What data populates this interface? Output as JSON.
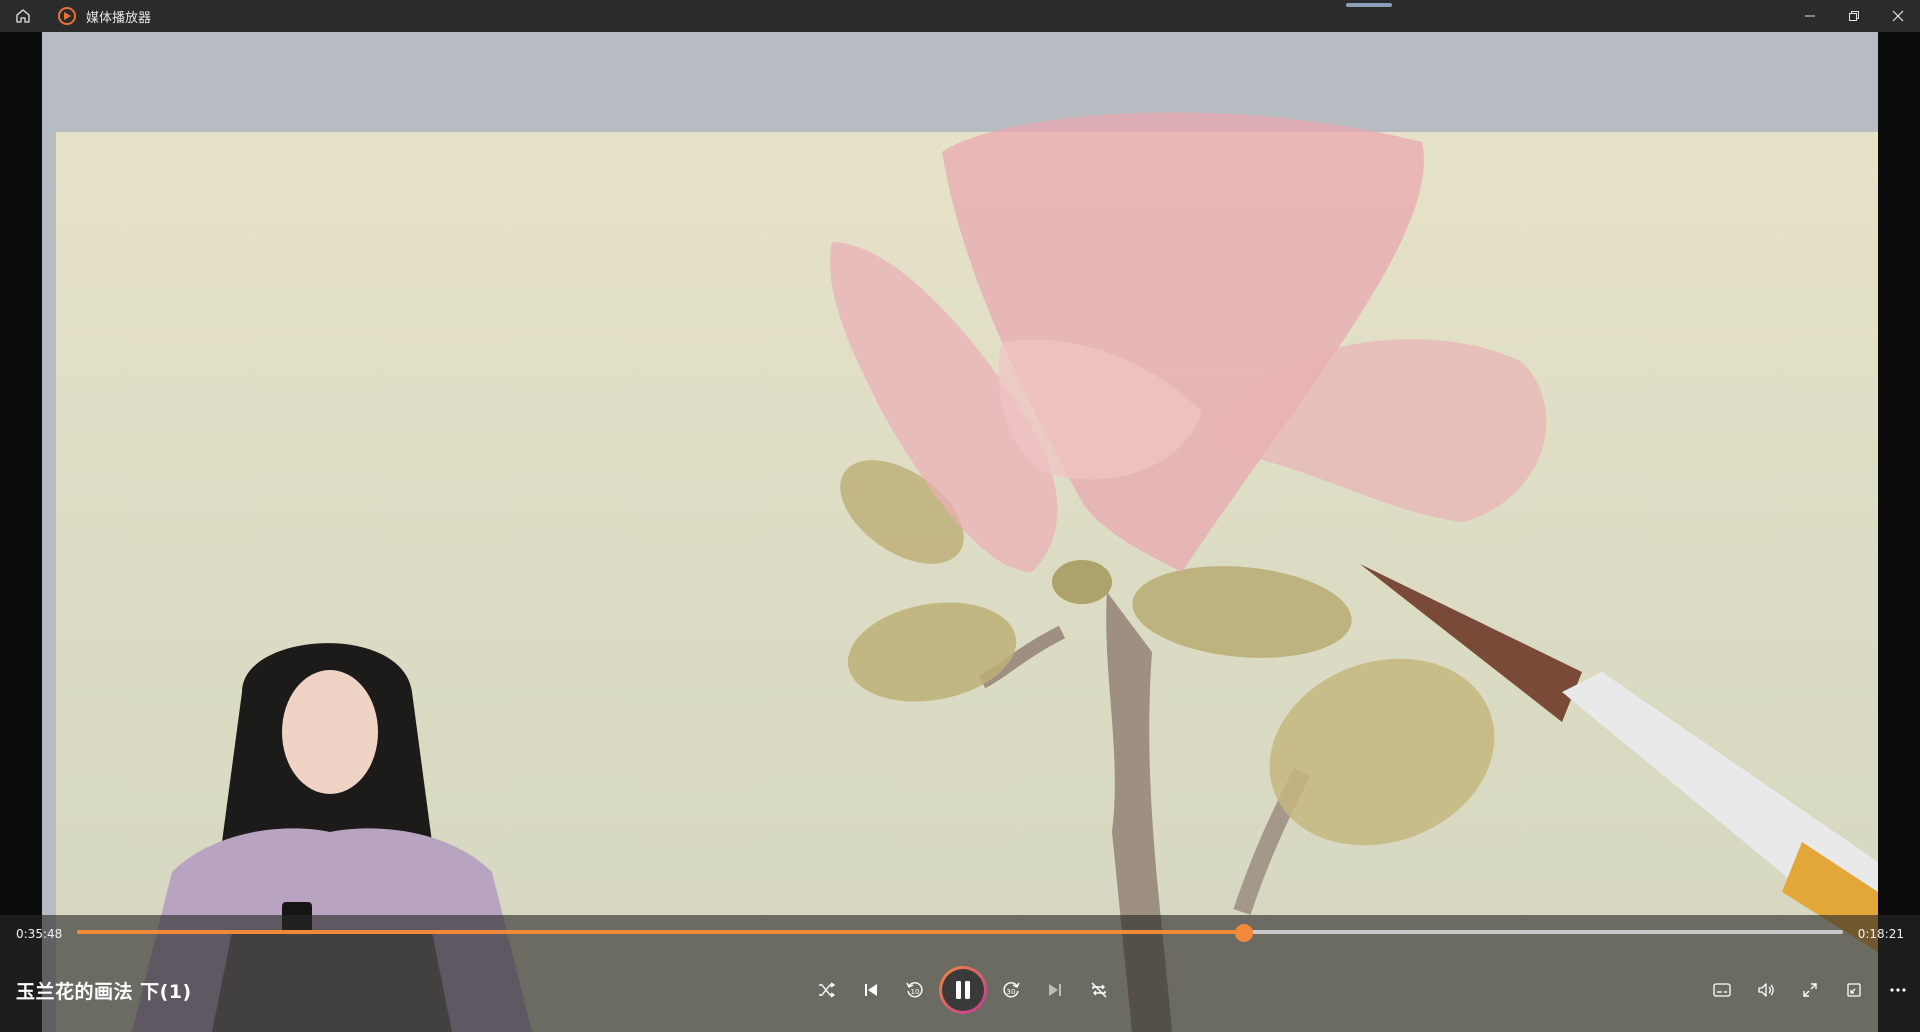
{
  "window": {
    "title": "媒体播放器",
    "icons": {
      "home": "home-icon",
      "app": "media-player-icon",
      "minimize": "minimize-icon",
      "restore": "restore-icon",
      "close": "close-icon"
    }
  },
  "player": {
    "elapsed": "0:35:48",
    "remaining": "0:18:21",
    "progress_fraction": 0.66,
    "video_title": "玉兰花的画法   下(1)",
    "accent_color": "#f08a3a",
    "play_gradient_end": "#c4379a",
    "state": "playing",
    "controls_center": [
      "shuffle-icon",
      "previous-icon",
      "rewind-10-icon",
      "pause-icon",
      "forward-30-icon",
      "next-icon",
      "repeat-off-icon"
    ],
    "controls_right": [
      "subtitles-icon",
      "volume-icon",
      "fullscreen-icon",
      "mini-player-icon",
      "more-icon"
    ],
    "rewind_label": "10",
    "forward_label": "30"
  }
}
